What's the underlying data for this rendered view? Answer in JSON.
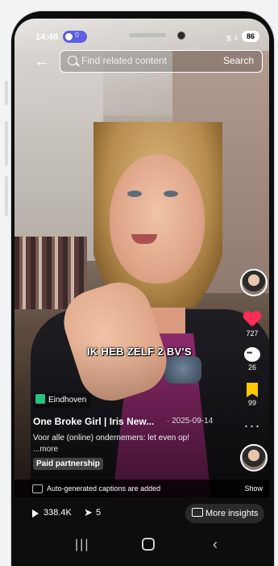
{
  "status_bar": {
    "time": "14:48",
    "notif_text": "0",
    "battery": "86"
  },
  "search": {
    "placeholder": "Find related content",
    "button": "Search"
  },
  "video": {
    "caption_overlay": "IK HEB ZELF 2 BV'S"
  },
  "rail": {
    "likes": "727",
    "comments": "26",
    "saves": "99"
  },
  "info": {
    "location": "Eindhoven",
    "author": "One Broke Girl | Iris New...",
    "date": "· 2025-09-14",
    "description": "Voor alle (online) ondernemers: let even op!",
    "more": "...more",
    "paid_label": "Paid partnership"
  },
  "captions": {
    "text": "Auto-generated captions are added",
    "show": "Show"
  },
  "stats": {
    "views": "338.4K",
    "shares": "5",
    "insights": "More insights"
  },
  "colors": {
    "like": "#ff2d55",
    "save": "#ffc700",
    "location": "#26c281",
    "notif": "#5b5fe0"
  },
  "icons": [
    "back-arrow-icon",
    "search-icon",
    "heart-icon",
    "comment-icon",
    "bookmark-icon",
    "more-icon",
    "location-icon",
    "captions-icon",
    "play-icon",
    "share-icon",
    "chart-icon",
    "recent-apps-icon",
    "home-icon",
    "back-icon"
  ]
}
